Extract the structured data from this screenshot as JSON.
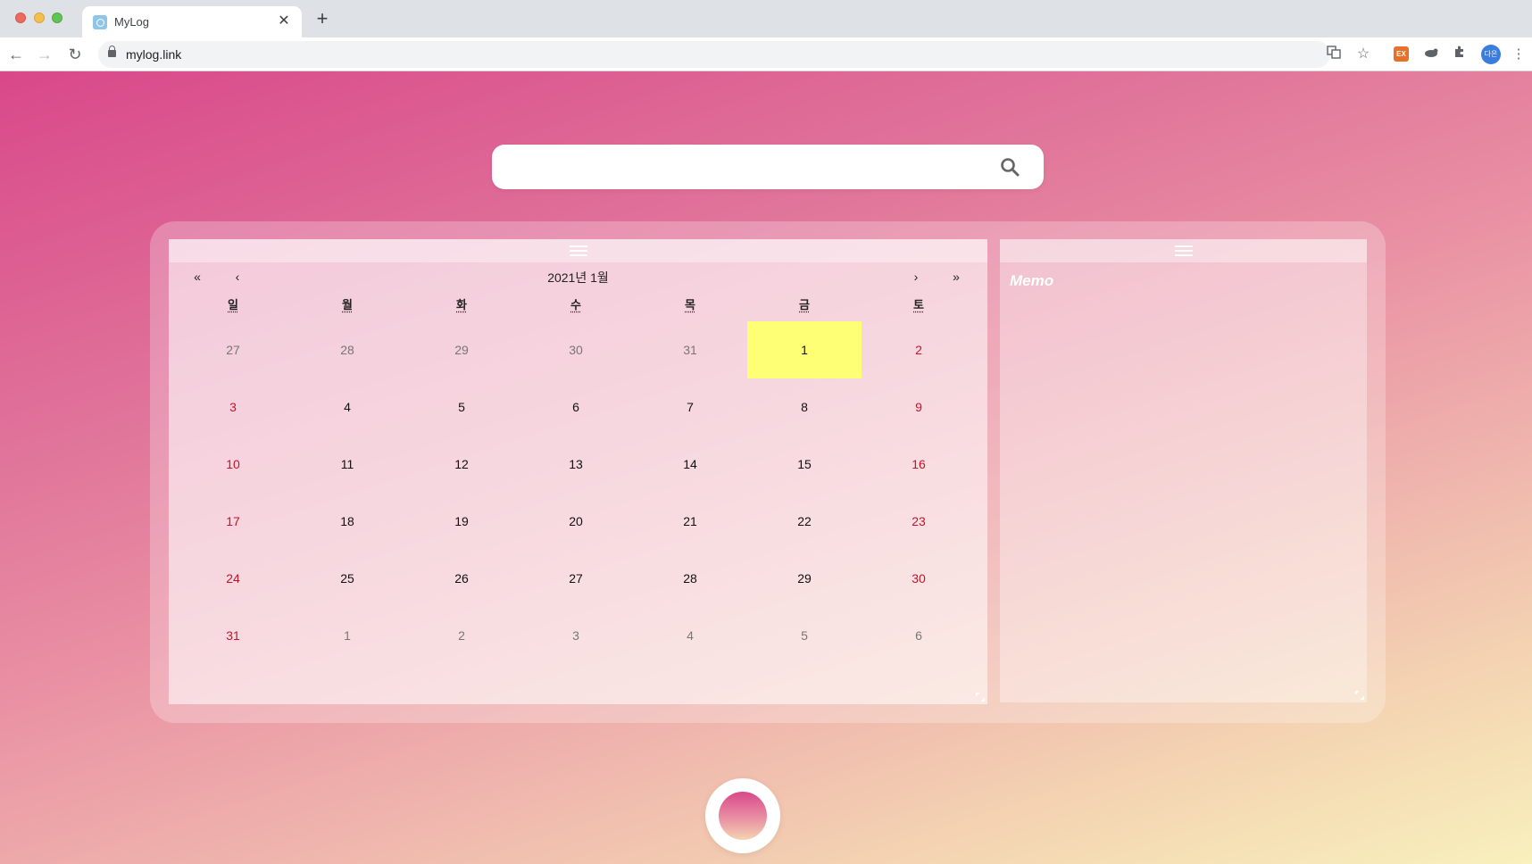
{
  "browser": {
    "tab": {
      "title": "MyLog",
      "close": "✕"
    },
    "new_tab": "+",
    "nav": {
      "back": "←",
      "forward": "→",
      "reload": "↻"
    },
    "url": "mylog.link",
    "extensions": {
      "ex_badge": "EX",
      "avatar_initials": "다은"
    }
  },
  "search": {
    "placeholder": "",
    "icon": "search-icon"
  },
  "calendar": {
    "nav": {
      "prev_year": "«",
      "prev_month": "‹",
      "next_month": "›",
      "next_year": "»"
    },
    "title": "2021년 1월",
    "weekdays": [
      "일",
      "월",
      "화",
      "수",
      "목",
      "금",
      "토"
    ],
    "days": [
      {
        "label": "27",
        "kind": "other"
      },
      {
        "label": "28",
        "kind": "other"
      },
      {
        "label": "29",
        "kind": "other"
      },
      {
        "label": "30",
        "kind": "other"
      },
      {
        "label": "31",
        "kind": "other"
      },
      {
        "label": "1",
        "kind": "today"
      },
      {
        "label": "2",
        "kind": "weekend"
      },
      {
        "label": "3",
        "kind": "weekend"
      },
      {
        "label": "4",
        "kind": "normal"
      },
      {
        "label": "5",
        "kind": "normal"
      },
      {
        "label": "6",
        "kind": "normal"
      },
      {
        "label": "7",
        "kind": "normal"
      },
      {
        "label": "8",
        "kind": "normal"
      },
      {
        "label": "9",
        "kind": "weekend"
      },
      {
        "label": "10",
        "kind": "weekend"
      },
      {
        "label": "11",
        "kind": "normal"
      },
      {
        "label": "12",
        "kind": "normal"
      },
      {
        "label": "13",
        "kind": "normal"
      },
      {
        "label": "14",
        "kind": "normal"
      },
      {
        "label": "15",
        "kind": "normal"
      },
      {
        "label": "16",
        "kind": "weekend"
      },
      {
        "label": "17",
        "kind": "weekend"
      },
      {
        "label": "18",
        "kind": "normal"
      },
      {
        "label": "19",
        "kind": "normal"
      },
      {
        "label": "20",
        "kind": "normal"
      },
      {
        "label": "21",
        "kind": "normal"
      },
      {
        "label": "22",
        "kind": "normal"
      },
      {
        "label": "23",
        "kind": "weekend"
      },
      {
        "label": "24",
        "kind": "weekend"
      },
      {
        "label": "25",
        "kind": "normal"
      },
      {
        "label": "26",
        "kind": "normal"
      },
      {
        "label": "27",
        "kind": "normal"
      },
      {
        "label": "28",
        "kind": "normal"
      },
      {
        "label": "29",
        "kind": "normal"
      },
      {
        "label": "30",
        "kind": "weekend"
      },
      {
        "label": "31",
        "kind": "weekend"
      },
      {
        "label": "1",
        "kind": "other"
      },
      {
        "label": "2",
        "kind": "other"
      },
      {
        "label": "3",
        "kind": "other"
      },
      {
        "label": "4",
        "kind": "other"
      },
      {
        "label": "5",
        "kind": "other"
      },
      {
        "label": "6",
        "kind": "other"
      }
    ]
  },
  "memo": {
    "title": "Memo"
  },
  "colors": {
    "today_highlight": "#ffff76",
    "weekend_text": "#c0152d",
    "gradient_start": "#d9488a",
    "gradient_end": "#f8f0bd"
  }
}
